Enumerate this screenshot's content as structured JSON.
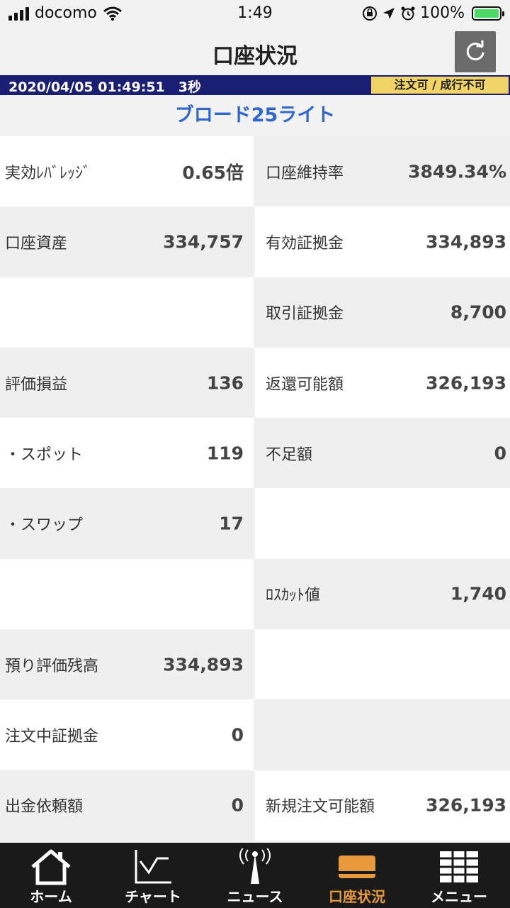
{
  "status_bar": {
    "carrier": "docomo",
    "time": "1:49",
    "battery_percent": "100%"
  },
  "header": {
    "title": "口座状況",
    "refresh_icon": "refresh-icon"
  },
  "info_bar": {
    "datetime": "2020/04/05 01:49:51　3秒",
    "order_status": "注文可 / 成行不可"
  },
  "course_name": "ブロード25ライト",
  "rows": [
    {
      "left_label": "実効ﾚﾊﾞﾚｯｼﾞ",
      "left_value": "0.65倍",
      "right_label": "口座維持率",
      "right_value": "3849.34%"
    },
    {
      "left_label": "口座資産",
      "left_value": "334,757",
      "right_label": "有効証拠金",
      "right_value": "334,893"
    },
    {
      "left_label": "",
      "left_value": "",
      "right_label": "取引証拠金",
      "right_value": "8,700"
    },
    {
      "left_label": "評価損益",
      "left_value": "136",
      "right_label": "返還可能額",
      "right_value": "326,193"
    },
    {
      "left_label": "・スポット",
      "left_value": "119",
      "right_label": "不足額",
      "right_value": "0"
    },
    {
      "left_label": "・スワップ",
      "left_value": "17",
      "right_label": "",
      "right_value": ""
    },
    {
      "left_label": "",
      "left_value": "",
      "right_label": "ﾛｽｶｯﾄ値",
      "right_value": "1,740"
    },
    {
      "left_label": "預り評価残高",
      "left_value": "334,893",
      "right_label": "",
      "right_value": ""
    },
    {
      "left_label": "注文中証拠金",
      "left_value": "0",
      "right_label": "",
      "right_value": ""
    },
    {
      "left_label": "出金依頼額",
      "left_value": "0",
      "right_label": "新規注文可能額",
      "right_value": "326,193"
    }
  ],
  "tabs": [
    {
      "label": "ホーム",
      "icon": "home-icon"
    },
    {
      "label": "チャート",
      "icon": "chart-icon"
    },
    {
      "label": "ニュース",
      "icon": "news-icon"
    },
    {
      "label": "口座状況",
      "icon": "account-icon",
      "active": true
    },
    {
      "label": "メニュー",
      "icon": "menu-icon"
    }
  ],
  "colors": {
    "info_bar_bg": "#1b1f73",
    "status_badge_bg": "#f2d466",
    "course_text": "#2f66d0",
    "active_tab": "#e89a3a",
    "tab_bar_bg": "#1a1a1a"
  }
}
